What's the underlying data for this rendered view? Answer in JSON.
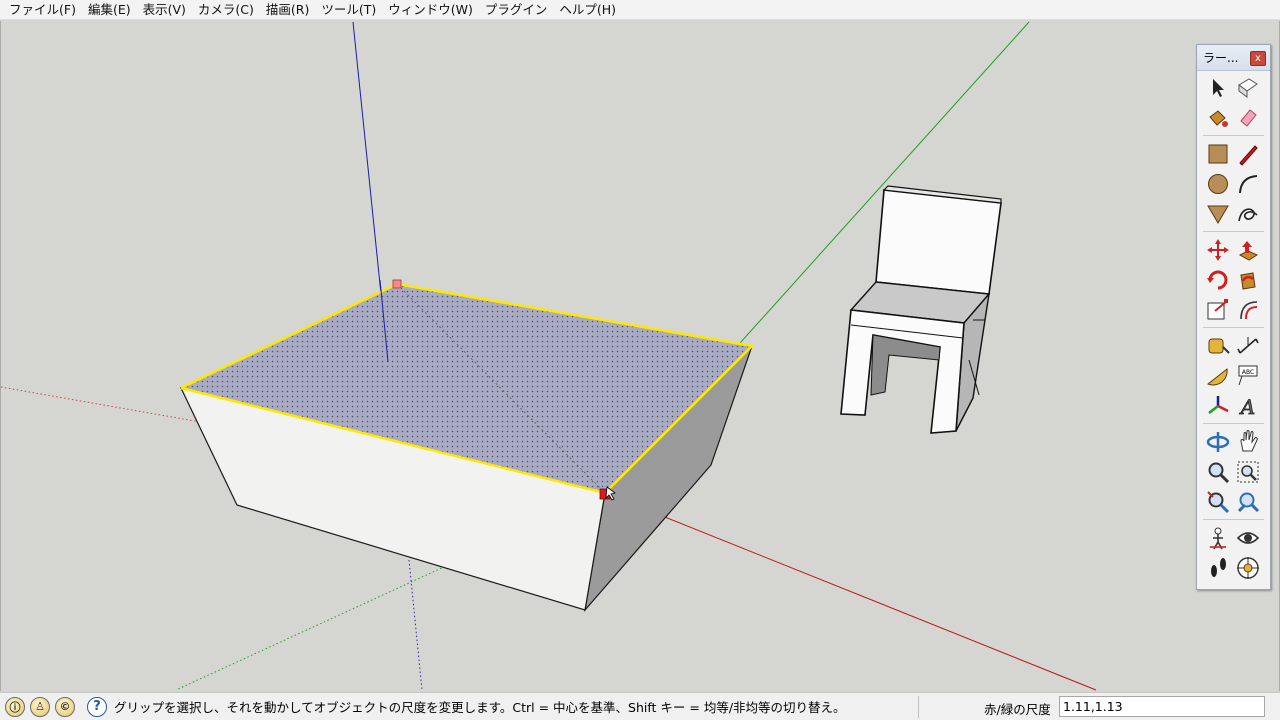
{
  "menubar": {
    "items": [
      "ファイル(F)",
      "編集(E)",
      "表示(V)",
      "カメラ(C)",
      "描画(R)",
      "ツール(T)",
      "ウィンドウ(W)",
      "プラグイン",
      "ヘルプ(H)"
    ]
  },
  "toolpanel": {
    "title": "ラー...",
    "close": "x",
    "tools": [
      {
        "name": "select-icon"
      },
      {
        "name": "component-icon"
      },
      {
        "name": "paint-bucket-icon"
      },
      {
        "name": "eraser-icon"
      },
      {
        "name": "rectangle-icon"
      },
      {
        "name": "pencil-line-icon"
      },
      {
        "name": "circle-icon"
      },
      {
        "name": "arc-icon"
      },
      {
        "name": "polygon-icon"
      },
      {
        "name": "freehand-icon"
      },
      {
        "name": "move-icon"
      },
      {
        "name": "push-pull-icon"
      },
      {
        "name": "rotate-icon"
      },
      {
        "name": "follow-me-icon"
      },
      {
        "name": "scale-icon"
      },
      {
        "name": "offset-icon"
      },
      {
        "name": "tape-measure-icon"
      },
      {
        "name": "dimension-icon"
      },
      {
        "name": "protractor-icon"
      },
      {
        "name": "text-icon"
      },
      {
        "name": "axes-icon"
      },
      {
        "name": "3d-text-icon"
      },
      {
        "name": "orbit-icon"
      },
      {
        "name": "pan-icon"
      },
      {
        "name": "zoom-icon"
      },
      {
        "name": "zoom-window-icon"
      },
      {
        "name": "zoom-extents-icon"
      },
      {
        "name": "previous-view-icon"
      },
      {
        "name": "position-camera-icon"
      },
      {
        "name": "look-around-icon"
      },
      {
        "name": "walk-icon"
      },
      {
        "name": "section-plane-icon"
      }
    ],
    "text_tool_label": "ABC"
  },
  "status": {
    "icons": [
      "info-icon",
      "person-icon",
      "credits-icon"
    ],
    "message": "グリップを選択し、それを動かしてオブジェクトの尺度を変更します。Ctrl = 中心を基準、Shift キー = 均等/非均等の切り替え。",
    "vcb_label": "赤/緑の尺度",
    "vcb_value": "1.11,1.13"
  },
  "colors": {
    "background": "#d5d5d1",
    "red_axis": "#cc1111",
    "green_axis": "#22aa22",
    "blue_axis": "#1a1aaa",
    "selection": "#ffee00",
    "top_face": "#a7a9c2",
    "front_face": "#f3f3f1",
    "side_face": "#9c9c9c"
  }
}
